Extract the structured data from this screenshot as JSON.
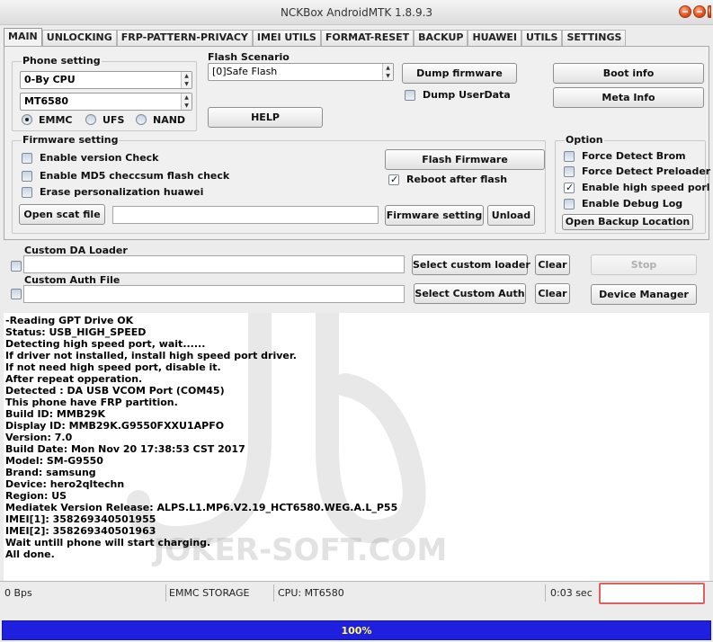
{
  "window": {
    "title": "NCKBox AndroidMTK 1.8.9.3",
    "colors": {
      "accent": "#1f1fe0",
      "progress_text": "#ffff66"
    }
  },
  "tabs": [
    {
      "label": "MAIN",
      "active": true
    },
    {
      "label": "UNLOCKING"
    },
    {
      "label": "FRP-PATTERN-PRIVACY"
    },
    {
      "label": "IMEI UTILS"
    },
    {
      "label": "FORMAT-RESET"
    },
    {
      "label": "BACKUP"
    },
    {
      "label": "HUAWEI"
    },
    {
      "label": "UTILS"
    },
    {
      "label": "SETTINGS"
    }
  ],
  "phone_setting": {
    "label": "Phone setting",
    "cpu_select": "0-By CPU",
    "chip_select": "MT6580",
    "storage_options": [
      "EMMC",
      "UFS",
      "NAND"
    ],
    "storage_selected": "EMMC"
  },
  "flash_scenario": {
    "label": "Flash Scenario",
    "value": "[0]Safe Flash"
  },
  "buttons": {
    "dump_firmware": "Dump firmware",
    "help": "HELP",
    "boot_info": "Boot info",
    "meta_info": "Meta Info",
    "flash_firmware": "Flash Firmware",
    "open_scat_file": "Open scat file",
    "firmware_setting": "Firmware setting",
    "unload": "Unload",
    "open_backup_location": "Open Backup Location",
    "select_custom_loader": "Select custom loader",
    "clear_loader": "Clear",
    "stop": "Stop",
    "select_custom_auth": "Select Custom Auth",
    "clear_auth": "Clear",
    "device_manager": "Device Manager"
  },
  "dump_userdata": {
    "label": "Dump UserData",
    "checked": false
  },
  "firmware_setting": {
    "label": "Firmware setting",
    "options": [
      {
        "label": "Enable version Check",
        "checked": false
      },
      {
        "label": "Enable MD5 checcsum flash check",
        "checked": false
      },
      {
        "label": "Erase personalization huawei",
        "checked": false
      }
    ],
    "reboot_after_flash": {
      "label": "Reboot after flash",
      "checked": true
    },
    "scat_path": ""
  },
  "option": {
    "label": "Option",
    "items": [
      {
        "label": "Force Detect Brom",
        "checked": false
      },
      {
        "label": "Force Detect Preloader",
        "checked": false
      },
      {
        "label": "Enable high speed porl",
        "checked": true
      },
      {
        "label": "Enable Debug Log",
        "checked": false
      }
    ]
  },
  "custom_da_loader": {
    "label": "Custom DA Loader",
    "value": ""
  },
  "custom_auth_file": {
    "label": "Custom Auth File",
    "value": ""
  },
  "log": [
    "-Reading GPT Drive OK",
    "Status: USB_HIGH_SPEED",
    "Detecting high speed port, wait......",
    "If driver not installed, install high speed port driver.",
    "If not need high speed port, disable it.",
    "After repeat opperation.",
    "Detected : DA USB VCOM Port (COM45)",
    "This phone have FRP partition.",
    "Build ID: MMB29K",
    "Display ID: MMB29K.G9550FXXU1APFO",
    "Version: 7.0",
    "Build Date: Mon Nov 20 17:38:53 CST 2017",
    "Model: SM-G9550",
    "Brand: samsung",
    "Device: hero2qltechn",
    "Region: US",
    "Mediatek Version Release: ALPS.L1.MP6.V2.19_HCT6580.WEG.A.L_P55",
    "IMEI[1]: 358269340501955",
    "IMEI[2]: 358269340501963",
    "Wait untill phone will start charging.",
    "All done."
  ],
  "watermark": {
    "text": "JOKER-SOFT.COM",
    "vertical_text": "JOKER SOFT"
  },
  "status": {
    "speed": "0 Bps",
    "storage": "EMMC STORAGE",
    "cpu": "CPU: MT6580",
    "time": "0:03 sec"
  },
  "progress": {
    "percent": 100,
    "label": "100%"
  }
}
